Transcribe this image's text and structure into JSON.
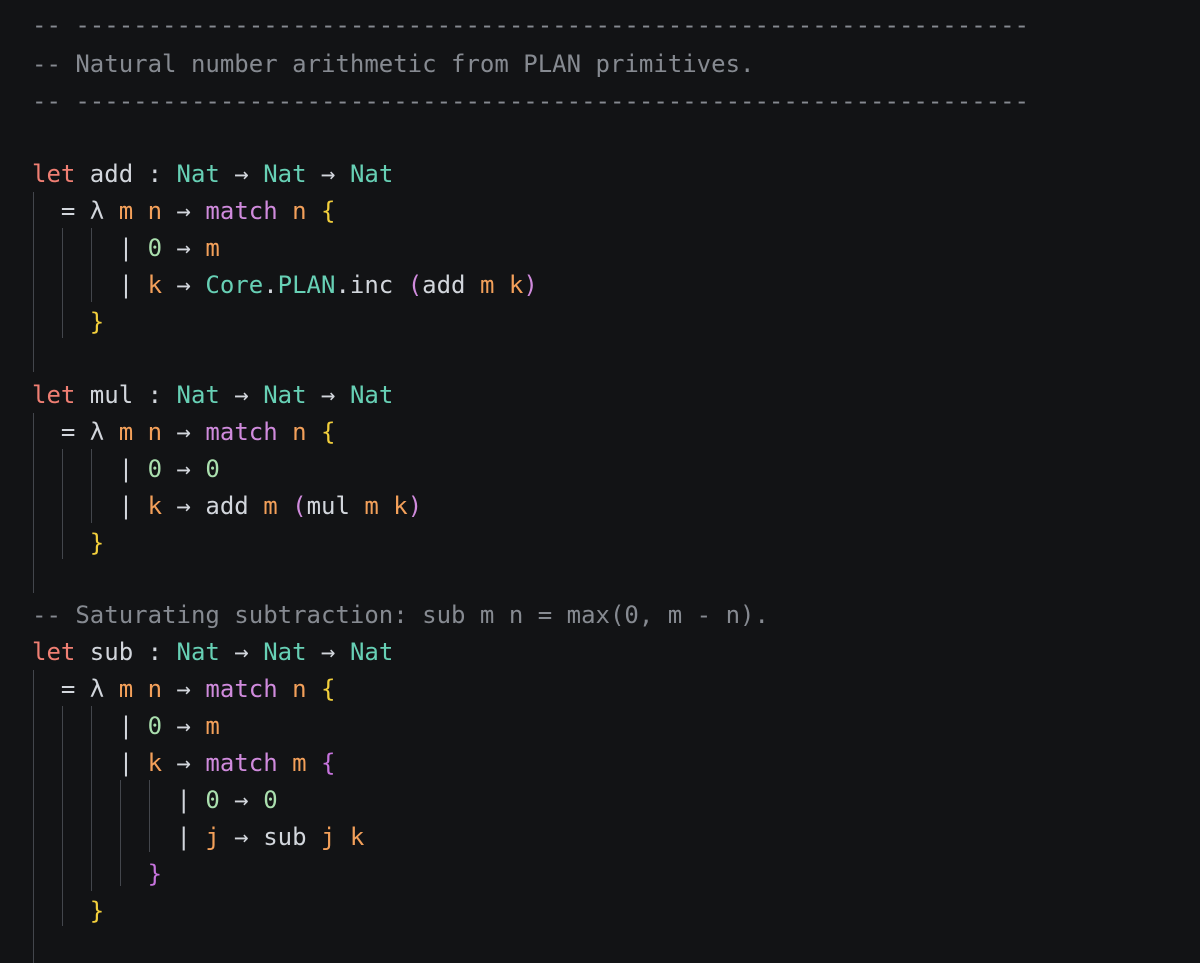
{
  "colors": {
    "background": "#121315",
    "comment": "#868a91",
    "keyword": "#f07f73",
    "type": "#67d0b5",
    "variable": "#f3a05a",
    "match": "#d08bdd",
    "brace_outer": "#f2cf3c",
    "brace_inner": "#c673dd",
    "number": "#aadfae",
    "text": "#d2d6dc"
  },
  "lines": [
    [
      {
        "k": "comment",
        "t": "-- ------------------------------------------------------------------"
      }
    ],
    [
      {
        "k": "comment",
        "t": "-- Natural number arithmetic from PLAN primitives."
      }
    ],
    [
      {
        "k": "comment",
        "t": "-- ------------------------------------------------------------------"
      }
    ],
    [],
    [
      {
        "k": "kw",
        "t": "let"
      },
      {
        "k": "plain",
        "t": " add : "
      },
      {
        "k": "type",
        "t": "Nat"
      },
      {
        "k": "plain",
        "t": " → "
      },
      {
        "k": "type",
        "t": "Nat"
      },
      {
        "k": "plain",
        "t": " → "
      },
      {
        "k": "type",
        "t": "Nat"
      }
    ],
    [
      {
        "k": "plain",
        "t": "  = λ "
      },
      {
        "k": "var",
        "t": "m"
      },
      {
        "k": "plain",
        "t": " "
      },
      {
        "k": "var",
        "t": "n"
      },
      {
        "k": "plain",
        "t": " → "
      },
      {
        "k": "match",
        "t": "match"
      },
      {
        "k": "plain",
        "t": " "
      },
      {
        "k": "var",
        "t": "n"
      },
      {
        "k": "plain",
        "t": " "
      },
      {
        "k": "brace-y",
        "t": "{"
      }
    ],
    [
      {
        "k": "plain",
        "t": "      | "
      },
      {
        "k": "num",
        "t": "0"
      },
      {
        "k": "plain",
        "t": " → "
      },
      {
        "k": "var",
        "t": "m"
      }
    ],
    [
      {
        "k": "plain",
        "t": "      | "
      },
      {
        "k": "var",
        "t": "k"
      },
      {
        "k": "plain",
        "t": " → "
      },
      {
        "k": "type",
        "t": "Core"
      },
      {
        "k": "plain",
        "t": "."
      },
      {
        "k": "type",
        "t": "PLAN"
      },
      {
        "k": "plain",
        "t": ".inc "
      },
      {
        "k": "match",
        "t": "("
      },
      {
        "k": "plain",
        "t": "add "
      },
      {
        "k": "var",
        "t": "m"
      },
      {
        "k": "plain",
        "t": " "
      },
      {
        "k": "var",
        "t": "k"
      },
      {
        "k": "match",
        "t": ")"
      }
    ],
    [
      {
        "k": "plain",
        "t": "    "
      },
      {
        "k": "brace-y",
        "t": "}"
      }
    ],
    [],
    [
      {
        "k": "kw",
        "t": "let"
      },
      {
        "k": "plain",
        "t": " mul : "
      },
      {
        "k": "type",
        "t": "Nat"
      },
      {
        "k": "plain",
        "t": " → "
      },
      {
        "k": "type",
        "t": "Nat"
      },
      {
        "k": "plain",
        "t": " → "
      },
      {
        "k": "type",
        "t": "Nat"
      }
    ],
    [
      {
        "k": "plain",
        "t": "  = λ "
      },
      {
        "k": "var",
        "t": "m"
      },
      {
        "k": "plain",
        "t": " "
      },
      {
        "k": "var",
        "t": "n"
      },
      {
        "k": "plain",
        "t": " → "
      },
      {
        "k": "match",
        "t": "match"
      },
      {
        "k": "plain",
        "t": " "
      },
      {
        "k": "var",
        "t": "n"
      },
      {
        "k": "plain",
        "t": " "
      },
      {
        "k": "brace-y",
        "t": "{"
      }
    ],
    [
      {
        "k": "plain",
        "t": "      | "
      },
      {
        "k": "num",
        "t": "0"
      },
      {
        "k": "plain",
        "t": " → "
      },
      {
        "k": "num",
        "t": "0"
      }
    ],
    [
      {
        "k": "plain",
        "t": "      | "
      },
      {
        "k": "var",
        "t": "k"
      },
      {
        "k": "plain",
        "t": " → add "
      },
      {
        "k": "var",
        "t": "m"
      },
      {
        "k": "plain",
        "t": " "
      },
      {
        "k": "match",
        "t": "("
      },
      {
        "k": "plain",
        "t": "mul "
      },
      {
        "k": "var",
        "t": "m"
      },
      {
        "k": "plain",
        "t": " "
      },
      {
        "k": "var",
        "t": "k"
      },
      {
        "k": "match",
        "t": ")"
      }
    ],
    [
      {
        "k": "plain",
        "t": "    "
      },
      {
        "k": "brace-y",
        "t": "}"
      }
    ],
    [],
    [
      {
        "k": "comment",
        "t": "-- Saturating subtraction: sub m n = max(0, m - n)."
      }
    ],
    [
      {
        "k": "kw",
        "t": "let"
      },
      {
        "k": "plain",
        "t": " sub : "
      },
      {
        "k": "type",
        "t": "Nat"
      },
      {
        "k": "plain",
        "t": " → "
      },
      {
        "k": "type",
        "t": "Nat"
      },
      {
        "k": "plain",
        "t": " → "
      },
      {
        "k": "type",
        "t": "Nat"
      }
    ],
    [
      {
        "k": "plain",
        "t": "  = λ "
      },
      {
        "k": "var",
        "t": "m"
      },
      {
        "k": "plain",
        "t": " "
      },
      {
        "k": "var",
        "t": "n"
      },
      {
        "k": "plain",
        "t": " → "
      },
      {
        "k": "match",
        "t": "match"
      },
      {
        "k": "plain",
        "t": " "
      },
      {
        "k": "var",
        "t": "n"
      },
      {
        "k": "plain",
        "t": " "
      },
      {
        "k": "brace-y",
        "t": "{"
      }
    ],
    [
      {
        "k": "plain",
        "t": "      | "
      },
      {
        "k": "num",
        "t": "0"
      },
      {
        "k": "plain",
        "t": " → "
      },
      {
        "k": "var",
        "t": "m"
      }
    ],
    [
      {
        "k": "plain",
        "t": "      | "
      },
      {
        "k": "var",
        "t": "k"
      },
      {
        "k": "plain",
        "t": " → "
      },
      {
        "k": "match",
        "t": "match"
      },
      {
        "k": "plain",
        "t": " "
      },
      {
        "k": "var",
        "t": "m"
      },
      {
        "k": "plain",
        "t": " "
      },
      {
        "k": "brace-p",
        "t": "{"
      }
    ],
    [
      {
        "k": "plain",
        "t": "          | "
      },
      {
        "k": "num",
        "t": "0"
      },
      {
        "k": "plain",
        "t": " → "
      },
      {
        "k": "num",
        "t": "0"
      }
    ],
    [
      {
        "k": "plain",
        "t": "          | "
      },
      {
        "k": "var",
        "t": "j"
      },
      {
        "k": "plain",
        "t": " → sub "
      },
      {
        "k": "var",
        "t": "j"
      },
      {
        "k": "plain",
        "t": " "
      },
      {
        "k": "var",
        "t": "k"
      }
    ],
    [
      {
        "k": "plain",
        "t": "        "
      },
      {
        "k": "brace-p",
        "t": "}"
      }
    ],
    [
      {
        "k": "plain",
        "t": "    "
      },
      {
        "k": "brace-y",
        "t": "}"
      }
    ]
  ]
}
